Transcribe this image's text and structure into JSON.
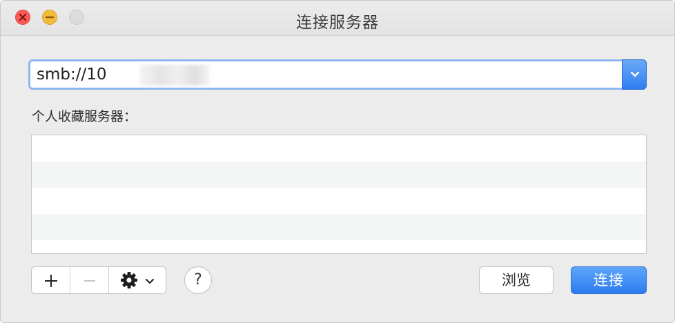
{
  "window": {
    "title": "连接服务器"
  },
  "address": {
    "value": "smb://10",
    "dropdown_icon": "chevron-down-icon"
  },
  "favorites": {
    "label": "个人收藏服务器：",
    "items": []
  },
  "toolbar": {
    "add_icon": "plus-icon",
    "remove_icon": "minus-icon",
    "action_icon": "gear-icon",
    "help_label": "?"
  },
  "buttons": {
    "browse_label": "浏览",
    "connect_label": "连接"
  },
  "colors": {
    "accent": "#2d7cf0",
    "close": "#fc5b57",
    "minimize": "#f3bb3c"
  }
}
